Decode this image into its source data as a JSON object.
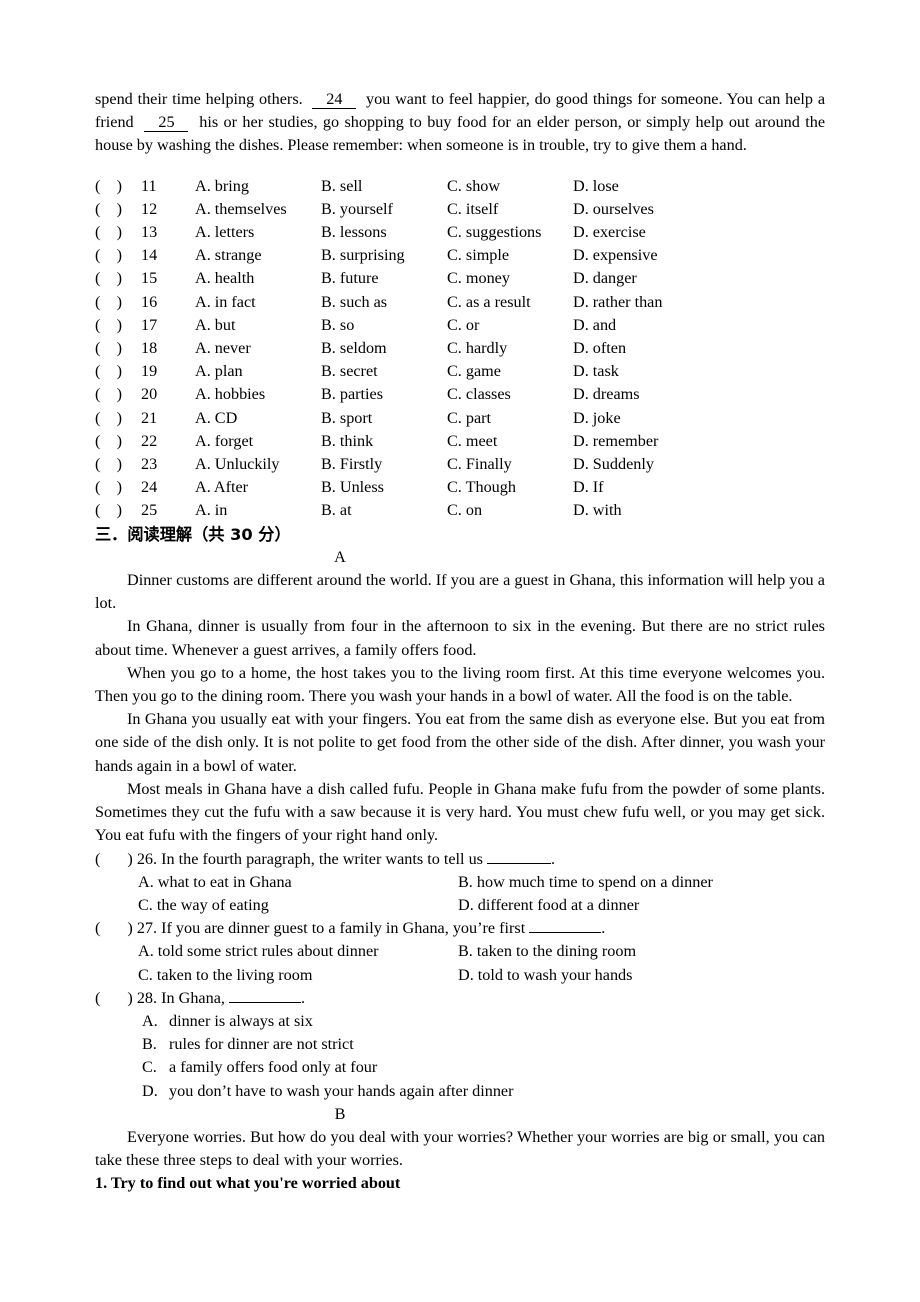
{
  "cloze_passage_tail": {
    "line_parts": {
      "before_24": "spend their time helping others.",
      "blank_24": "24",
      "after_24": "you want to feel happier, do good things for someone. You can help a friend",
      "blank_25": "25",
      "after_25": "his or her studies, go shopping to buy food for an elder person, or simply help out around the house by washing the dishes. Please remember: when someone is in trouble, try to give them a hand."
    }
  },
  "mc_grid": {
    "open_paren": "(",
    "close_paren": ")",
    "rows": [
      {
        "num": "11",
        "a": "A. bring",
        "b": "B. sell",
        "c": "C. show",
        "d": "D. lose"
      },
      {
        "num": "12",
        "a": "A. themselves",
        "b": "B. yourself",
        "c": "C. itself",
        "d": "D. ourselves"
      },
      {
        "num": "13",
        "a": "A. letters",
        "b": "B. lessons",
        "c": "C. suggestions",
        "d": "D. exercise"
      },
      {
        "num": "14",
        "a": "A. strange",
        "b": "B. surprising",
        "c": "C. simple",
        "d": "D. expensive"
      },
      {
        "num": "15",
        "a": "A. health",
        "b": "B. future",
        "c": "C. money",
        "d": "D. danger"
      },
      {
        "num": "16",
        "a": "A. in fact",
        "b": "B. such as",
        "c": "C. as a result",
        "d": "D. rather than"
      },
      {
        "num": "17",
        "a": "A. but",
        "b": "B. so",
        "c": "C. or",
        "d": "D. and"
      },
      {
        "num": "18",
        "a": "A. never",
        "b": "B. seldom",
        "c": "C. hardly",
        "d": "D. often"
      },
      {
        "num": "19",
        "a": "A. plan",
        "b": "B. secret",
        "c": "C. game",
        "d": "D. task"
      },
      {
        "num": "20",
        "a": "A. hobbies",
        "b": "B. parties",
        "c": "C. classes",
        "d": "D. dreams"
      },
      {
        "num": "21",
        "a": "A. CD",
        "b": "B. sport",
        "c": "C. part",
        "d": "D. joke"
      },
      {
        "num": "22",
        "a": "A. forget",
        "b": "B. think",
        "c": "C. meet",
        "d": "D. remember"
      },
      {
        "num": "23",
        "a": "A. Unluckily",
        "b": "B. Firstly",
        "c": "C. Finally",
        "d": "D. Suddenly"
      },
      {
        "num": "24",
        "a": "A. After",
        "b": "B. Unless",
        "c": "C. Though",
        "d": "D. If"
      },
      {
        "num": "25",
        "a": "A. in",
        "b": "B. at",
        "c": "C. on",
        "d": "D. with"
      }
    ]
  },
  "section_three": {
    "heading": "三．阅读理解（共 30 分）"
  },
  "passage_a": {
    "label": "A",
    "paragraphs": [
      "Dinner customs are different around the world. If you are a guest in Ghana, this information will help you a lot.",
      "In Ghana, dinner is usually from four in the afternoon to six in the evening. But there are no strict rules about time. Whenever a guest arrives, a family offers food.",
      "When you go to a home, the host takes you to the living room first. At this time everyone welcomes you. Then you go to the dining room. There you wash your hands in a bowl of water. All the food is on the table.",
      "In Ghana you usually eat with your fingers. You eat from the same dish as everyone else. But you eat from one side of the dish only. It is not polite to get food from the other side of the dish. After dinner, you wash your hands again in a bowl of water.",
      "Most meals in Ghana have a dish called fufu. People in Ghana make fufu from the powder of some plants. Sometimes they cut the fufu with a saw because it is very hard. You must chew fufu well, or you may get sick. You eat fufu with the fingers of your right hand only."
    ],
    "questions": [
      {
        "open_paren": "(",
        "close_paren": ")",
        "stem_before": "26. In the fourth paragraph, the writer wants to tell us",
        "stem_after": ".",
        "layout": "two-column",
        "options": [
          "A. what to eat in Ghana",
          "B. how much time to spend on a dinner",
          "C. the way of eating",
          "D. different food at a dinner"
        ]
      },
      {
        "open_paren": "(",
        "close_paren": ")",
        "stem_before": "27. If you are dinner guest to a family in Ghana, you’re first",
        "stem_after": ".",
        "layout": "two-column",
        "options": [
          "A. told some strict rules about dinner",
          "B. taken to the dining room",
          "C. taken to the living room",
          "D. told to wash your hands"
        ]
      },
      {
        "open_paren": "(",
        "close_paren": ")",
        "stem_before": "28. In Ghana,",
        "stem_after": ".",
        "layout": "stacked",
        "options_letters": [
          "A.",
          "B.",
          "C.",
          "D."
        ],
        "options_text": [
          "dinner is always at six",
          "rules for dinner are not strict",
          "a family offers food only at four",
          "you don’t have to wash your hands again after dinner"
        ]
      }
    ]
  },
  "passage_b": {
    "label": "B",
    "paragraphs": [
      "Everyone worries. But how do you deal with your worries? Whether your worries are big or small, you can take these three steps to deal with your worries."
    ],
    "subheading": "1. Try to find out what you're worried about"
  }
}
